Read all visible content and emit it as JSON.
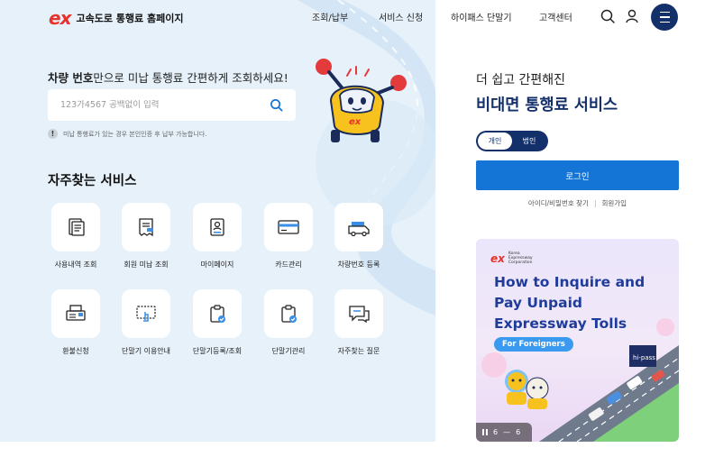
{
  "header": {
    "logo_mark": "ex",
    "site_title": "고속도로 통행료 홈페이지",
    "nav": [
      "조회/납부",
      "서비스 신청",
      "하이패스 단말기",
      "고객센터"
    ]
  },
  "search": {
    "headline_bold": "차량 번호",
    "headline_rest": "만으로 미납 통행료 간편하게 조회하세요!",
    "placeholder": "123가4567 공백없이 입력",
    "notice_mark": "!",
    "notice": "미납 통행료가 있는 경우 본인인증 후 납부 가능합니다."
  },
  "services": {
    "title": "자주찾는 서비스",
    "items": [
      {
        "label": "사용내역 조회",
        "icon": "document-list-icon"
      },
      {
        "label": "회원 미납 조회",
        "icon": "receipt-icon"
      },
      {
        "label": "마이페이지",
        "icon": "id-card-icon"
      },
      {
        "label": "카드관리",
        "icon": "credit-card-icon"
      },
      {
        "label": "차량번호 등록",
        "icon": "truck-icon"
      },
      {
        "label": "환불신청",
        "icon": "printer-icon"
      },
      {
        "label": "단말기 이용안내",
        "icon": "touch-screen-icon"
      },
      {
        "label": "단말기등록/조회",
        "icon": "clipboard-check-icon"
      },
      {
        "label": "단말기관리",
        "icon": "clipboard-check-icon"
      },
      {
        "label": "자주찾는 질문",
        "icon": "chat-bubble-icon"
      }
    ]
  },
  "panel": {
    "subtitle": "더 쉽고 간편해진",
    "title": "비대면 통행료 서비스",
    "toggle": [
      "개인",
      "법인"
    ],
    "login_label": "로그인",
    "link_find": "아이디/비밀번호 찾기",
    "link_separator": "|",
    "link_join": "회원가입"
  },
  "banner": {
    "logo_mark": "ex",
    "logo_text": "Korea Expressway Corporation",
    "heading": "How to Inquire and Pay Unpaid Expressway Tolls",
    "pill": "For Foreigners",
    "sign_text": "hi-pass",
    "pager_current": "6",
    "pager_separator": "—",
    "pager_total": "6"
  },
  "colors": {
    "brand_navy": "#13306b",
    "brand_blue": "#1475d6",
    "brand_red": "#e8322c"
  }
}
